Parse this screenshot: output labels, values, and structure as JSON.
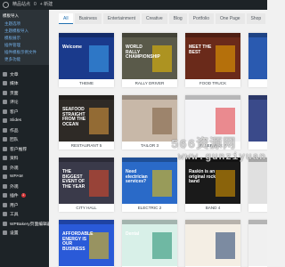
{
  "admin_bar": {
    "site": "精品站点",
    "comments": "0",
    "new": "+ 新建"
  },
  "sidebar": {
    "header": "模板导入",
    "subitems": [
      "主题选项",
      "主题模板导入",
      "模板展示",
      "插件管理",
      "插件模板示例文件",
      "更多功能"
    ],
    "items": [
      {
        "label": "文章",
        "icon": "pin-icon"
      },
      {
        "label": "媒体",
        "icon": "media-icon"
      },
      {
        "label": "页面",
        "icon": "page-icon"
      },
      {
        "label": "评论",
        "icon": "comment-icon"
      },
      {
        "label": "客户",
        "icon": "users-icon"
      },
      {
        "label": "Slides",
        "icon": "slides-icon"
      },
      {
        "label": "作品",
        "icon": "portfolio-icon"
      },
      {
        "label": "团队",
        "icon": "team-icon"
      },
      {
        "label": "客户推荐",
        "icon": "quote-icon"
      },
      {
        "label": "资料",
        "icon": "data-icon"
      },
      {
        "label": "外观",
        "icon": "brush-icon"
      },
      {
        "label": "WPAM",
        "icon": "wpam-icon"
      },
      {
        "label": "外观",
        "icon": "appearance-icon"
      },
      {
        "label": "插件",
        "icon": "plugin-icon",
        "badge": "1"
      },
      {
        "label": "用户",
        "icon": "user-icon"
      },
      {
        "label": "工具",
        "icon": "tools-icon"
      },
      {
        "label": "WPBakery页面编辑器",
        "icon": "wpbakery-icon"
      },
      {
        "label": "设置",
        "icon": "settings-icon"
      }
    ]
  },
  "tabs": [
    "All",
    "Business",
    "Entertainment",
    "Creative",
    "Blog",
    "Portfolio",
    "One Page",
    "Shop",
    "Other"
  ],
  "cards": [
    {
      "caption": "THEME",
      "bg": "#1a3a8c",
      "accent": "#3fa9f5",
      "headline": "Welcome"
    },
    {
      "caption": "RALLY DRIVER",
      "bg": "#5a5a4a",
      "accent": "#f2c200",
      "headline": "WORLD RALLY CHAMPIONSHIP"
    },
    {
      "caption": "FOOD TRUCK",
      "bg": "#6a2a1a",
      "accent": "#f2a900",
      "headline": "MEET THE BEST"
    },
    {
      "caption": "",
      "bg": "#2a5ab0",
      "accent": "#ffffff",
      "headline": ""
    },
    {
      "caption": "RESTAURANT 5",
      "bg": "#2e2a26",
      "accent": "#e8a040",
      "headline": "SEAFOOD STRAIGHT FROM THE OCEAN"
    },
    {
      "caption": "TAILOR 3",
      "bg": "#c8b8a8",
      "accent": "#7a5a3a",
      "headline": ""
    },
    {
      "caption": "IT SERVICE 3",
      "bg": "#f4f4f6",
      "accent": "#e2333a",
      "headline": ""
    },
    {
      "caption": "",
      "bg": "#3a4a8a",
      "accent": "#ffffff",
      "headline": ""
    },
    {
      "caption": "CITY HALL",
      "bg": "#3a3a4a",
      "accent": "#e64a2a",
      "headline": "THE BIGGEST EVENT OF THE YEAR"
    },
    {
      "caption": "ELECTRIC 2",
      "bg": "#2a6ac8",
      "accent": "#f2c200",
      "headline": "Need electrician services?"
    },
    {
      "caption": "BAND 4",
      "bg": "#1a1a1a",
      "accent": "#e8a000",
      "headline": "Raskin is an original rock band"
    },
    {
      "caption": "",
      "bg": "#e0e0e0",
      "accent": "#333333",
      "headline": ""
    },
    {
      "caption": "",
      "bg": "#2a5ad8",
      "accent": "#f2c200",
      "headline": "AFFORDABLE ENERGY IS OUR BUSINESS"
    },
    {
      "caption": "",
      "bg": "#d8f0e8",
      "accent": "#1a8a6a",
      "headline": "Dental"
    },
    {
      "caption": "",
      "bg": "#f4eee4",
      "accent": "#1a3a6a",
      "headline": ""
    },
    {
      "caption": "",
      "bg": "#f0f0f0",
      "accent": "#3a6ad8",
      "headline": ""
    }
  ],
  "watermark": {
    "line1": "566资源网",
    "line2": "www.gunziyuan"
  }
}
